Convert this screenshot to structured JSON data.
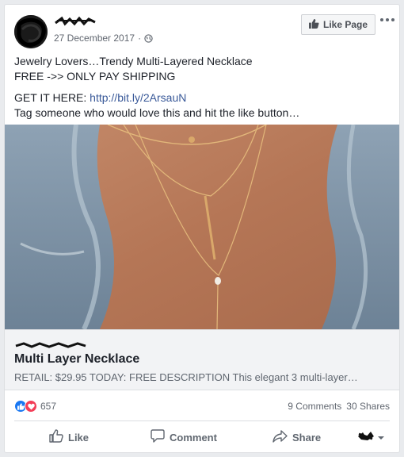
{
  "header": {
    "date": "27 December 2017",
    "separator": "·",
    "like_page_label": "Like Page"
  },
  "post": {
    "line1": "Jewelry Lovers…Trendy Multi-Layered Necklace",
    "line2": "FREE ->> ONLY PAY SHIPPING",
    "line3_prefix": "GET IT HERE: ",
    "line3_link": "http://bit.ly/2ArsauN",
    "line4": "Tag someone who would love this and hit the like button…"
  },
  "link_preview": {
    "title": "Multi Layer Necklace",
    "description": "RETAIL: $29.95 TODAY: FREE DESCRIPTION This elegant 3 multi-layer…"
  },
  "stats": {
    "reaction_count": "657",
    "comments": "9 Comments",
    "shares": "30 Shares"
  },
  "actions": {
    "like": "Like",
    "comment": "Comment",
    "share": "Share"
  },
  "colors": {
    "link": "#385898",
    "like_blue": "#1877f2",
    "love_red": "#f33e58"
  },
  "icons": [
    "globe-icon",
    "thumbs-up-icon",
    "more-icon",
    "like-reaction-icon",
    "love-reaction-icon",
    "comment-icon",
    "share-icon",
    "chevron-down-icon"
  ]
}
